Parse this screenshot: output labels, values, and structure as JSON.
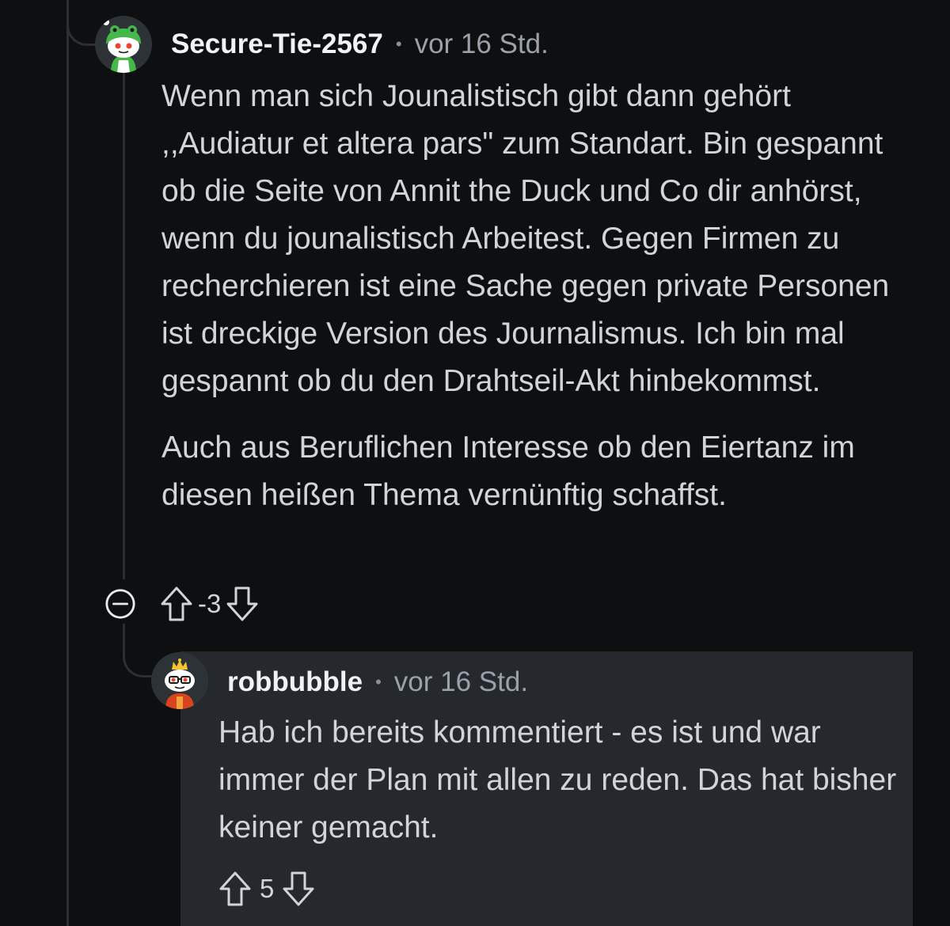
{
  "comment": {
    "username": "Secure-Tie-2567",
    "separator": "•",
    "timestamp": "vor 16 Std.",
    "paragraphs": [
      "Wenn man sich Jounalistisch gibt dann gehört ,,Audiatur et altera pars\" zum Standart. Bin gespannt ob die Seite von Annit the Duck und Co dir anhörst, wenn du jounalistisch Arbeitest. Gegen Firmen zu recherchieren ist eine Sache gegen private Personen ist dreckige Version des Journalismus. Ich bin mal gespannt ob du den Drahtseil-Akt hinbekommst.",
      "Auch aus Beruflichen Interesse ob den Eiertanz im diesen heißen Thema vernünftig schaffst."
    ],
    "score": "-3",
    "icons": {
      "collapse": "collapse-minus-icon",
      "upvote": "upvote-arrow-icon",
      "downvote": "downvote-arrow-icon",
      "avatar": "snoo-avatar-green"
    }
  },
  "reply": {
    "username": "robbubble",
    "separator": "•",
    "timestamp": "vor 16 Std.",
    "paragraphs": [
      "Hab ich bereits kommentiert - es ist und war immer der Plan mit allen zu reden. Das hat bisher keiner gemacht."
    ],
    "score": "5",
    "icons": {
      "upvote": "upvote-arrow-icon",
      "downvote": "downvote-arrow-icon",
      "avatar": "snoo-avatar-crown"
    }
  },
  "colors": {
    "background": "#0e0f10",
    "reply_background": "#25292d",
    "thread_line": "#2b2f33",
    "text": "#d1d5d9",
    "muted": "#9aa1a8"
  }
}
